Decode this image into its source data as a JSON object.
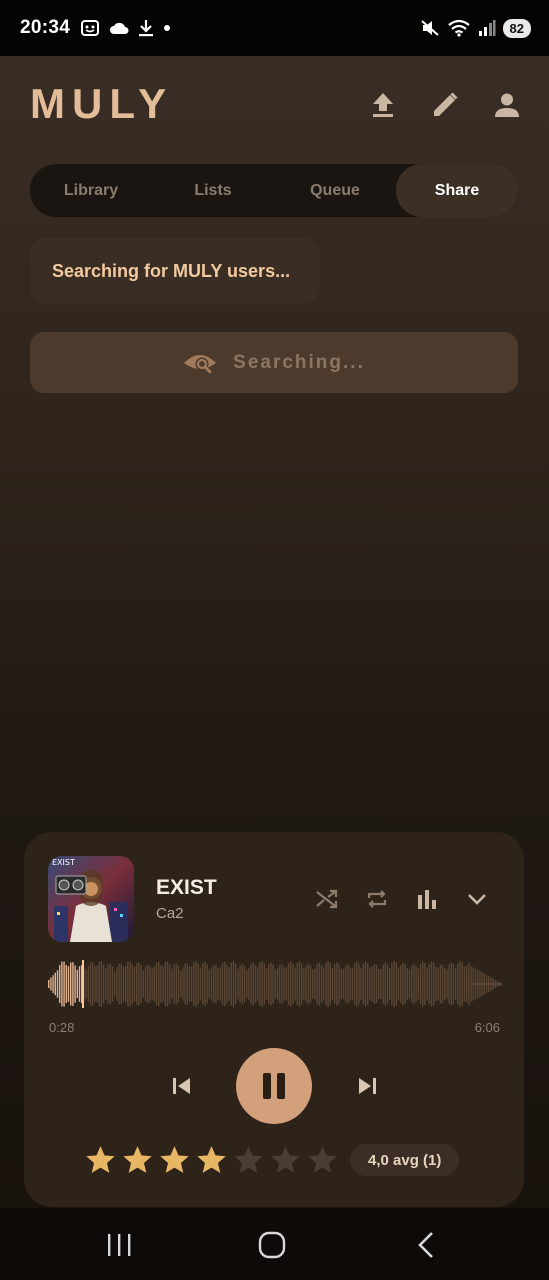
{
  "status_bar": {
    "time": "20:34",
    "battery": "82"
  },
  "app": {
    "title": "MULY"
  },
  "tabs": [
    {
      "label": "Library",
      "active": false
    },
    {
      "label": "Lists",
      "active": false
    },
    {
      "label": "Queue",
      "active": false
    },
    {
      "label": "Share",
      "active": true
    }
  ],
  "share": {
    "status_text": "Searching for MULY users...",
    "search_label": "Searching..."
  },
  "player": {
    "title": "EXIST",
    "artist": "Ca2",
    "current_time": "0:28",
    "total_time": "6:06",
    "progress": 0.077,
    "rating": 4,
    "rating_max": 7,
    "avg_label": "4,0 avg (1)"
  },
  "colors": {
    "accent": "#e2bd98",
    "play_button": "#d3a07c",
    "star_on": "#e8b766",
    "star_off": "#4a3d31"
  }
}
